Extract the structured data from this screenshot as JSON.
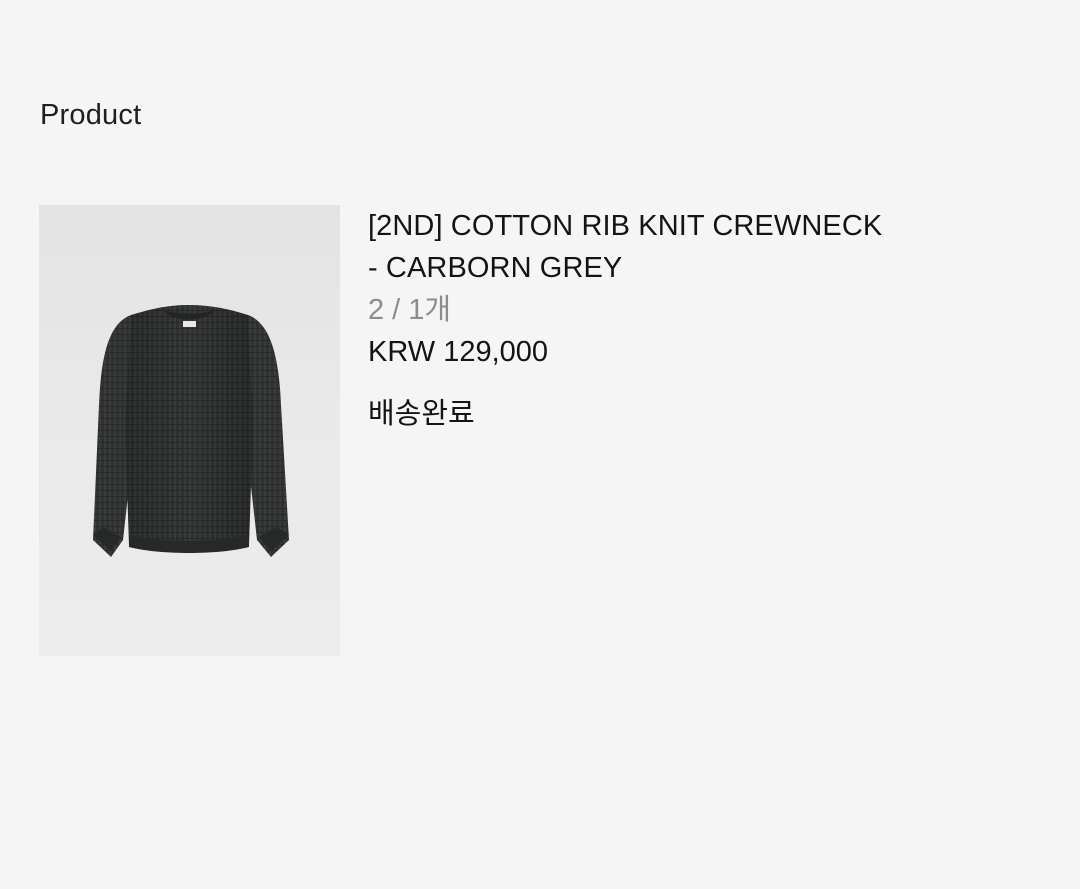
{
  "section": {
    "title": "Product"
  },
  "product": {
    "name_line1": "[2ND] COTTON RIB KNIT CREWNECK",
    "name_line2": "- CARBORN GREY",
    "quantity": "2 / 1개",
    "price": "KRW 129,000",
    "status": "배송완료",
    "image_subject": "sweater-photo"
  }
}
